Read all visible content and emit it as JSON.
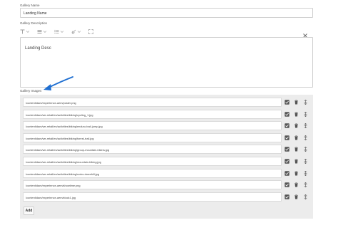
{
  "form": {
    "gallery_name_label": "Gallery Name",
    "gallery_name_value": "Landing Name",
    "gallery_description_label": "Gallery Description",
    "gallery_description_value": "Landing Desc",
    "gallery_images_label": "Gallery Images",
    "add_label": "Add"
  },
  "toolbar": {
    "icons": [
      "text-format-icon",
      "paragraph-icon",
      "list-icon",
      "link-icon",
      "fullscreen-icon",
      "close-icon"
    ]
  },
  "gallery": {
    "items": [
      {
        "path": "/content/dam/experience-aem/poster.png"
      },
      {
        "path": "/content/dam/we-retail/en/activities/biking/cycling_1.jpg"
      },
      {
        "path": "/content/dam/we-retail/en/activities/biking/enduro-trail-jump.jpg"
      },
      {
        "path": "/content/dam/we-retail/en/activities/biking/forest-trail.jpg"
      },
      {
        "path": "/content/dam/we-retail/en/activities/biking/group-mountain-bikers.jpg"
      },
      {
        "path": "/content/dam/we-retail/en/activities/biking/mountain-biking.jpg"
      },
      {
        "path": "/content/dam/we-retail/en/activities/biking/rocks-downhill.jpg"
      },
      {
        "path": "/content/dam/experience-aem/showtime.png"
      },
      {
        "path": "/content/dam/experience-aem/stock1.jpg"
      }
    ]
  },
  "colors": {
    "annotation_arrow": "#1f6fd1",
    "gallery_bg": "#ececec"
  }
}
